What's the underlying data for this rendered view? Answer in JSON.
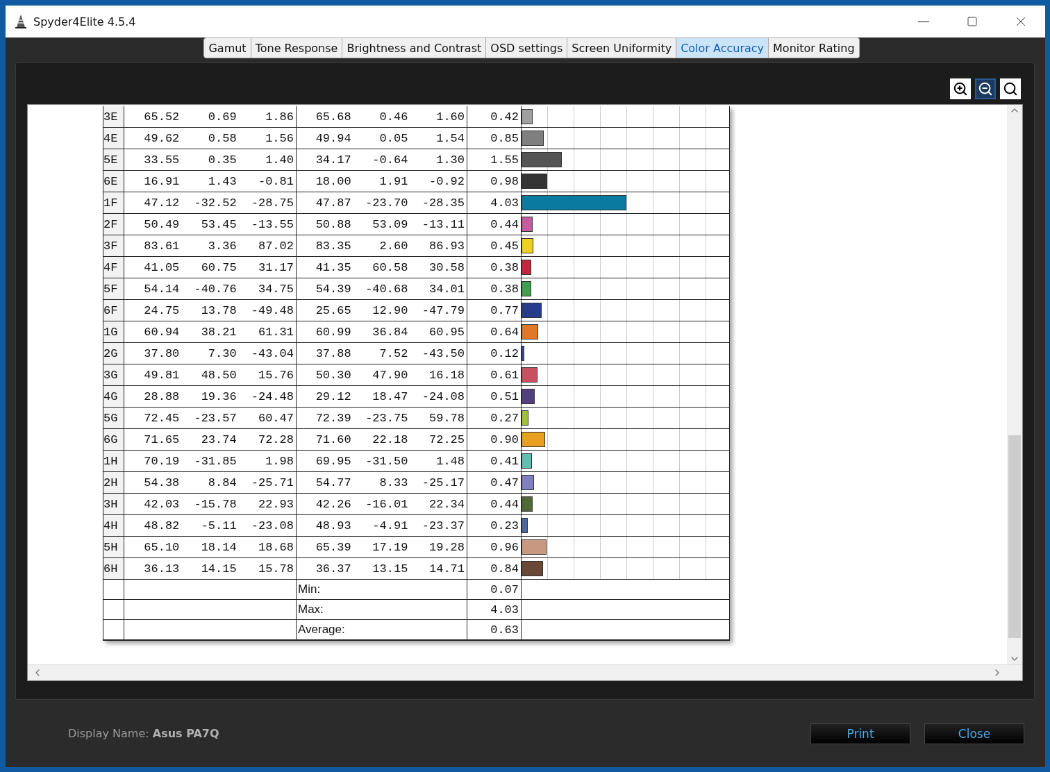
{
  "window": {
    "title": "Spyder4Elite 4.5.4"
  },
  "tabs": [
    {
      "label": "Gamut",
      "selected": false
    },
    {
      "label": "Tone Response",
      "selected": false
    },
    {
      "label": "Brightness and Contrast",
      "selected": false
    },
    {
      "label": "OSD settings",
      "selected": false
    },
    {
      "label": "Screen Uniformity",
      "selected": false
    },
    {
      "label": "Color Accuracy",
      "selected": true
    },
    {
      "label": "Monitor Rating",
      "selected": false
    }
  ],
  "zoom_buttons": [
    {
      "kind": "zoom_in",
      "selected": false
    },
    {
      "kind": "zoom_out",
      "selected": true
    },
    {
      "kind": "fit",
      "selected": false
    }
  ],
  "report": {
    "rows": [
      {
        "patch": "3E",
        "ref_l": "65.52",
        "ref_a": "0.69",
        "ref_b": "1.86",
        "meas_l": "65.68",
        "meas_a": "0.46",
        "meas_b": "1.60",
        "delta_e": "0.42",
        "level": 0.0525,
        "color": "#a0a0a0"
      },
      {
        "patch": "4E",
        "ref_l": "49.62",
        "ref_a": "0.58",
        "ref_b": "1.56",
        "meas_l": "49.94",
        "meas_a": "0.05",
        "meas_b": "1.54",
        "delta_e": "0.85",
        "level": 0.106,
        "color": "#7f7f7f"
      },
      {
        "patch": "5E",
        "ref_l": "33.55",
        "ref_a": "0.35",
        "ref_b": "1.40",
        "meas_l": "34.17",
        "meas_a": "-0.64",
        "meas_b": "1.30",
        "delta_e": "1.55",
        "level": 0.194,
        "color": "#555555"
      },
      {
        "patch": "6E",
        "ref_l": "16.91",
        "ref_a": "1.43",
        "ref_b": "-0.81",
        "meas_l": "18.00",
        "meas_a": "1.91",
        "meas_b": "-0.92",
        "delta_e": "0.98",
        "level": 0.1225,
        "color": "#333333"
      },
      {
        "patch": "1F",
        "ref_l": "47.12",
        "ref_a": "-32.52",
        "ref_b": "-28.75",
        "meas_l": "47.87",
        "meas_a": "-23.70",
        "meas_b": "-28.35",
        "delta_e": "4.03",
        "level": 0.504,
        "color": "#0b7aa0"
      },
      {
        "patch": "2F",
        "ref_l": "50.49",
        "ref_a": "53.45",
        "ref_b": "-13.55",
        "meas_l": "50.88",
        "meas_a": "53.09",
        "meas_b": "-13.11",
        "delta_e": "0.44",
        "level": 0.055,
        "color": "#c85aa0"
      },
      {
        "patch": "3F",
        "ref_l": "83.61",
        "ref_a": "3.36",
        "ref_b": "87.02",
        "meas_l": "83.35",
        "meas_a": "2.60",
        "meas_b": "86.93",
        "delta_e": "0.45",
        "level": 0.056,
        "color": "#f0d020"
      },
      {
        "patch": "4F",
        "ref_l": "41.05",
        "ref_a": "60.75",
        "ref_b": "31.17",
        "meas_l": "41.35",
        "meas_a": "60.58",
        "meas_b": "30.58",
        "delta_e": "0.38",
        "level": 0.0475,
        "color": "#c02840"
      },
      {
        "patch": "5F",
        "ref_l": "54.14",
        "ref_a": "-40.76",
        "ref_b": "34.75",
        "meas_l": "54.39",
        "meas_a": "-40.68",
        "meas_b": "34.01",
        "delta_e": "0.38",
        "level": 0.0475,
        "color": "#40a050"
      },
      {
        "patch": "6F",
        "ref_l": "24.75",
        "ref_a": "13.78",
        "ref_b": "-49.48",
        "meas_l": "25.65",
        "meas_a": "12.90",
        "meas_b": "-47.79",
        "delta_e": "0.77",
        "level": 0.096,
        "color": "#283c8c"
      },
      {
        "patch": "1G",
        "ref_l": "60.94",
        "ref_a": "38.21",
        "ref_b": "61.31",
        "meas_l": "60.99",
        "meas_a": "36.84",
        "meas_b": "60.95",
        "delta_e": "0.64",
        "level": 0.08,
        "color": "#e07828"
      },
      {
        "patch": "2G",
        "ref_l": "37.80",
        "ref_a": "7.30",
        "ref_b": "-43.04",
        "meas_l": "37.88",
        "meas_a": "7.52",
        "meas_b": "-43.50",
        "delta_e": "0.12",
        "level": 0.015,
        "color": "#3850a0"
      },
      {
        "patch": "3G",
        "ref_l": "49.81",
        "ref_a": "48.50",
        "ref_b": "15.76",
        "meas_l": "50.30",
        "meas_a": "47.90",
        "meas_b": "16.18",
        "delta_e": "0.61",
        "level": 0.076,
        "color": "#c85060"
      },
      {
        "patch": "4G",
        "ref_l": "28.88",
        "ref_a": "19.36",
        "ref_b": "-24.48",
        "meas_l": "29.12",
        "meas_a": "18.47",
        "meas_b": "-24.08",
        "delta_e": "0.51",
        "level": 0.064,
        "color": "#504080"
      },
      {
        "patch": "5G",
        "ref_l": "72.45",
        "ref_a": "-23.57",
        "ref_b": "60.47",
        "meas_l": "72.39",
        "meas_a": "-23.75",
        "meas_b": "59.78",
        "delta_e": "0.27",
        "level": 0.034,
        "color": "#a0c040"
      },
      {
        "patch": "6G",
        "ref_l": "71.65",
        "ref_a": "23.74",
        "ref_b": "72.28",
        "meas_l": "71.60",
        "meas_a": "22.18",
        "meas_b": "72.25",
        "delta_e": "0.90",
        "level": 0.1125,
        "color": "#e8a020"
      },
      {
        "patch": "1H",
        "ref_l": "70.19",
        "ref_a": "-31.85",
        "ref_b": "1.98",
        "meas_l": "69.95",
        "meas_a": "-31.50",
        "meas_b": "1.48",
        "delta_e": "0.41",
        "level": 0.051,
        "color": "#60c0b0"
      },
      {
        "patch": "2H",
        "ref_l": "54.38",
        "ref_a": "8.84",
        "ref_b": "-25.71",
        "meas_l": "54.77",
        "meas_a": "8.33",
        "meas_b": "-25.17",
        "delta_e": "0.47",
        "level": 0.059,
        "color": "#8080c0"
      },
      {
        "patch": "3H",
        "ref_l": "42.03",
        "ref_a": "-15.78",
        "ref_b": "22.93",
        "meas_l": "42.26",
        "meas_a": "-16.01",
        "meas_b": "22.34",
        "delta_e": "0.44",
        "level": 0.055,
        "color": "#506838"
      },
      {
        "patch": "4H",
        "ref_l": "48.82",
        "ref_a": "-5.11",
        "ref_b": "-23.08",
        "meas_l": "48.93",
        "meas_a": "-4.91",
        "meas_b": "-23.37",
        "delta_e": "0.23",
        "level": 0.029,
        "color": "#4868a0"
      },
      {
        "patch": "5H",
        "ref_l": "65.10",
        "ref_a": "18.14",
        "ref_b": "18.68",
        "meas_l": "65.39",
        "meas_a": "17.19",
        "meas_b": "19.28",
        "delta_e": "0.96",
        "level": 0.12,
        "color": "#c89880"
      },
      {
        "patch": "6H",
        "ref_l": "36.13",
        "ref_a": "14.15",
        "ref_b": "15.78",
        "meas_l": "36.37",
        "meas_a": "13.15",
        "meas_b": "14.71",
        "delta_e": "0.84",
        "level": 0.105,
        "color": "#6a4838"
      }
    ],
    "summary": [
      {
        "label": "Min:",
        "value": "0.07"
      },
      {
        "label": "Max:",
        "value": "4.03"
      },
      {
        "label": "Average:",
        "value": "0.63"
      }
    ]
  },
  "footer": {
    "display_name": "Display Name: **Asus PA7Q**",
    "buttons": [
      "Print",
      "Close"
    ]
  }
}
